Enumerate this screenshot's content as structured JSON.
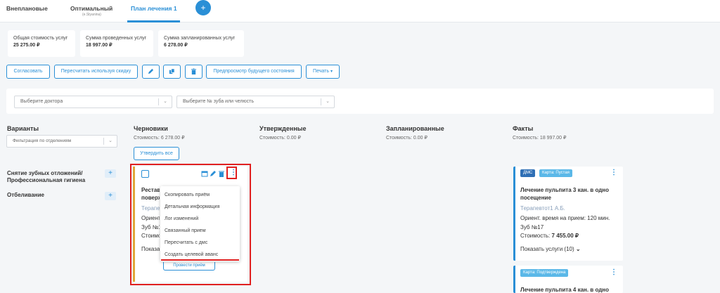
{
  "tabs": [
    {
      "label": "Внеплановые"
    },
    {
      "label": "Оптимальный",
      "sub": "(e.Styanina)"
    },
    {
      "label": "План лечения 1"
    }
  ],
  "add_tab_label": "+",
  "summary": [
    {
      "label": "Общая стоимость услуг",
      "value": "25 275.00 ₽"
    },
    {
      "label": "Сумма проведенных услуг",
      "value": "18 997.00 ₽"
    },
    {
      "label": "Сумма запланированных услуг",
      "value": "6 278.00 ₽"
    }
  ],
  "toolbar": {
    "agree": "Согласовать",
    "recalc": "Пересчитать используя скидку",
    "preview": "Предпросмотр будущего состояния",
    "print": "Печать"
  },
  "filters": {
    "doctor_placeholder": "Выберите доктора",
    "tooth_placeholder": "Выберите № зуба или челюсть"
  },
  "columns": {
    "variants": {
      "title": "Варианты",
      "filter_placeholder": "Фильтрация по отделениям"
    },
    "drafts": {
      "title": "Черновики",
      "cost": "Стоимость: 6 278.00 ₽",
      "approve_all": "Утвердить все"
    },
    "approved": {
      "title": "Утвержденные",
      "cost": "Стоимость: 0.00 ₽"
    },
    "planned": {
      "title": "Запланированные",
      "cost": "Стоимость: 0.00 ₽"
    },
    "facts": {
      "title": "Факты",
      "cost": "Стоимость: 18 997.00 ₽"
    }
  },
  "side_items": [
    {
      "line1": "Снятие зубных отложений/",
      "line2": "Профессиональная гигиена"
    },
    {
      "line1": "Отбеливание",
      "line2": ""
    }
  ],
  "plus_label": "+",
  "draft_card": {
    "title_line1": "Реставр",
    "title_line2": "поверх",
    "doctor": "Терапев",
    "orient": "Ориент",
    "tooth": "Зуб №1",
    "cost": "Стоимо",
    "show": "Показат",
    "bottom_btn": "Провести приём"
  },
  "menu_items": [
    "Скопировать приём",
    "Детальная информация",
    "Лог изменений",
    "Связанный прием",
    "Пересчитать с дмс",
    "Создать целевой аванс"
  ],
  "fact_cards": [
    {
      "badges": [
        "ДМС",
        "Карта: Пустая"
      ],
      "title_line1": "Лечение пульпита 3 кан. в одно",
      "title_line2": "посещение",
      "doctor": "Терапевтот1 А.Б.",
      "orient": "Ориент. время на прием: 120 мин.",
      "tooth": "Зуб №17",
      "cost_label": "Стоимость:",
      "cost_value": "7 455.00 ₽",
      "show": "Показать услуги (10)"
    },
    {
      "badges": [
        "Карта: Подтверждена"
      ],
      "title_line1": "Лечение пульпита 4 кан. в одно"
    }
  ],
  "colors": {
    "accent": "#2a8fd6",
    "highlight": "#e02020",
    "draft_border": "#e0a83a",
    "badge_dms": "#2f6fb5",
    "badge_card": "#5bb8e8"
  }
}
